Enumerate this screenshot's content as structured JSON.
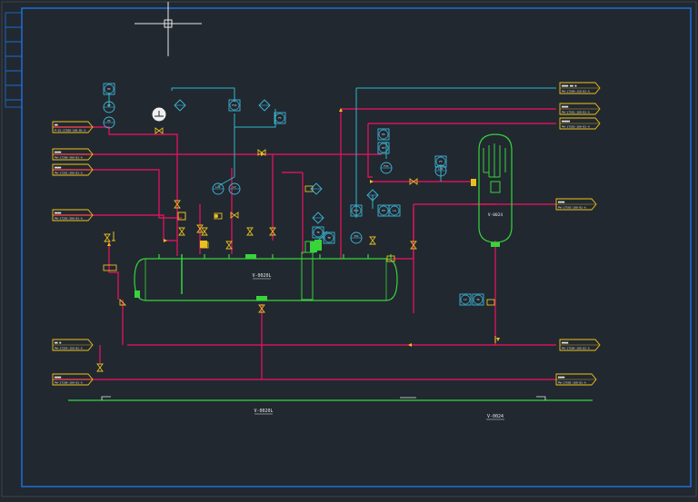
{
  "colors": {
    "background": "#212830",
    "frame": "#1f6fd6",
    "process_line": "#d4145a",
    "signal_line": "#2ab7c9",
    "equipment": "#38d43a",
    "tag_box": "#f0c419",
    "instrument": "#3fb8d8",
    "valve": "#e8c020",
    "text": "#e8e8e8"
  },
  "offsheet_tags": [
    {
      "id": "L1",
      "l1": "■■",
      "l2": "P-01-17200-100-B1-A"
    },
    {
      "id": "L2",
      "l1": "■■■■",
      "l2": "PW-17200-200-B1-A"
    },
    {
      "id": "L3",
      "l1": "■■■■",
      "l2": "PW-17201-200-B1-A"
    },
    {
      "id": "L4",
      "l1": "■■■■",
      "l2": "PW-17202-200-B1-A"
    },
    {
      "id": "L5",
      "l1": "■■ ■",
      "l2": "PW-17203-150-B1-A"
    },
    {
      "id": "L6",
      "l1": "■■■■",
      "l2": "PW-17100-100-B1-A"
    },
    {
      "id": "R1",
      "l1": "■■■■ ■■ ■",
      "l2": "PW-17500-150-B1-A"
    },
    {
      "id": "R2",
      "l1": "■■■■",
      "l2": "PW-17501-100-B1-A"
    },
    {
      "id": "R3",
      "l1": "■■■■■",
      "l2": "PW-17502-100-B1-A"
    },
    {
      "id": "R4",
      "l1": "■■■■",
      "l2": "PW-17503-100-B1-A"
    },
    {
      "id": "R5",
      "l1": "■■■■",
      "l2": "PW-17504-100-B1-A"
    },
    {
      "id": "R6",
      "l1": "■■■■",
      "l2": "PW-17505-100-B1-A"
    }
  ],
  "equipment": {
    "horizontal_vessel": "V-0020L",
    "vertical_vessel": "V-0024",
    "bottom_label_left": "V-0020L",
    "bottom_label_right": "V-0024"
  },
  "instruments": [
    {
      "id": "I1",
      "tag": "PI"
    },
    {
      "id": "I2",
      "tag": "PT"
    },
    {
      "id": "I3",
      "tag": "FIC"
    },
    {
      "id": "I4",
      "tag": "FT"
    },
    {
      "id": "I5",
      "tag": "LIC"
    },
    {
      "id": "I6",
      "tag": "LT"
    },
    {
      "id": "I7",
      "tag": "TI"
    },
    {
      "id": "I8",
      "tag": "TE"
    },
    {
      "id": "I9",
      "tag": "PIC"
    },
    {
      "id": "I10",
      "tag": "PV"
    },
    {
      "id": "I11",
      "tag": "LG"
    },
    {
      "id": "I12",
      "tag": "TIC"
    }
  ]
}
